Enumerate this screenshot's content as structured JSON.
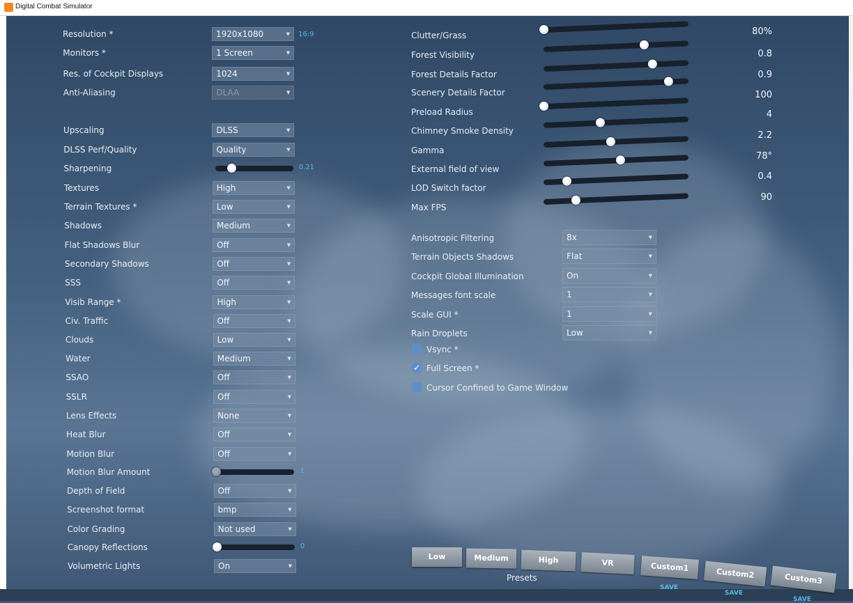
{
  "window": {
    "title": "Digital Combat Simulator"
  },
  "left": {
    "rows": [
      {
        "label": "Resolution *",
        "type": "dropdown",
        "value": "1920x1080",
        "extra": "16:9"
      },
      {
        "label": "Monitors *",
        "type": "dropdown",
        "value": "1 Screen"
      },
      {
        "label": "Res. of Cockpit Displays",
        "type": "dropdown",
        "value": "1024"
      },
      {
        "label": "Anti-Aliasing",
        "type": "dropdown",
        "value": "DLAA",
        "disabled": true
      },
      {
        "label": "Upscaling",
        "type": "dropdown",
        "value": "DLSS"
      },
      {
        "label": "DLSS Perf/Quality",
        "type": "dropdown",
        "value": "Quality"
      },
      {
        "label": "Sharpening",
        "type": "slider",
        "value": "0.21",
        "level": 0.21
      },
      {
        "label": "Textures",
        "type": "dropdown",
        "value": "High"
      },
      {
        "label": "Terrain Textures *",
        "type": "dropdown",
        "value": "Low"
      },
      {
        "label": "Shadows",
        "type": "dropdown",
        "value": "Medium"
      },
      {
        "label": "Flat Shadows Blur",
        "type": "dropdown",
        "value": "Off"
      },
      {
        "label": "Secondary Shadows",
        "type": "dropdown",
        "value": "Off"
      },
      {
        "label": "SSS",
        "type": "dropdown",
        "value": "Off"
      },
      {
        "label": "Visib Range *",
        "type": "dropdown",
        "value": "High"
      },
      {
        "label": "Civ. Traffic",
        "type": "dropdown",
        "value": "Off"
      },
      {
        "label": "Clouds",
        "type": "dropdown",
        "value": "Low"
      },
      {
        "label": "Water",
        "type": "dropdown",
        "value": "Medium"
      },
      {
        "label": "SSAO",
        "type": "dropdown",
        "value": "Off"
      },
      {
        "label": "SSLR",
        "type": "dropdown",
        "value": "Off"
      },
      {
        "label": "Lens Effects",
        "type": "dropdown",
        "value": "None"
      },
      {
        "label": "Heat Blur",
        "type": "dropdown",
        "value": "Off"
      },
      {
        "label": "Motion Blur",
        "type": "dropdown",
        "value": "Off"
      },
      {
        "label": "Motion Blur Amount",
        "type": "slider",
        "value": "1",
        "level": 0.0,
        "disabled": true
      },
      {
        "label": "Depth of Field",
        "type": "dropdown",
        "value": "Off"
      },
      {
        "label": "Screenshot format",
        "type": "dropdown",
        "value": "bmp"
      },
      {
        "label": "Color Grading",
        "type": "dropdown",
        "value": "Not used"
      },
      {
        "label": "Canopy Reflections",
        "type": "slider",
        "value": "0",
        "level": 0.0
      },
      {
        "label": "Volumetric Lights",
        "type": "dropdown",
        "value": "On"
      }
    ]
  },
  "right_sliders": [
    {
      "label": "Clutter/Grass",
      "value": "80%",
      "level": 0.0
    },
    {
      "label": "Forest Visibility",
      "value": "0.8",
      "level": 0.69
    },
    {
      "label": "Forest Details Factor",
      "value": "0.9",
      "level": 0.75
    },
    {
      "label": "Scenery Details Factor",
      "value": "100",
      "level": 0.86
    },
    {
      "label": "Preload Radius",
      "value": "4",
      "level": 0.0
    },
    {
      "label": "Chimney Smoke Density",
      "value": "2.2",
      "level": 0.39
    },
    {
      "label": "Gamma",
      "value": "78°",
      "level": 0.46
    },
    {
      "label": "External field of view",
      "value": "0.4",
      "level": 0.53
    },
    {
      "label": "LOD Switch factor",
      "value": "90",
      "level": 0.16
    },
    {
      "label": "Max FPS",
      "value": "",
      "level": 0.22
    }
  ],
  "right_dropdowns": [
    {
      "label": "Anisotropic Filtering",
      "value": "8x"
    },
    {
      "label": "Terrain Objects Shadows",
      "value": "Flat"
    },
    {
      "label": "Cockpit Global Illumination",
      "value": "On"
    },
    {
      "label": "Messages font scale",
      "value": "1"
    },
    {
      "label": "Scale GUI *",
      "value": "1"
    },
    {
      "label": "Rain Droplets",
      "value": "Low"
    }
  ],
  "checkboxes": [
    {
      "label": "Vsync *",
      "checked": false
    },
    {
      "label": "Full Screen *",
      "checked": true
    },
    {
      "label": "Cursor Confined to Game Window",
      "checked": false
    }
  ],
  "presets": {
    "caption": "Presets",
    "buttons": [
      "Low",
      "Medium",
      "High",
      "VR",
      "Custom1",
      "Custom2",
      "Custom3"
    ],
    "save_label": "SAVE"
  },
  "colors": {
    "accent": "#5ab7e4",
    "checkbox": "#5e8ec6",
    "background": "#3c5877"
  }
}
